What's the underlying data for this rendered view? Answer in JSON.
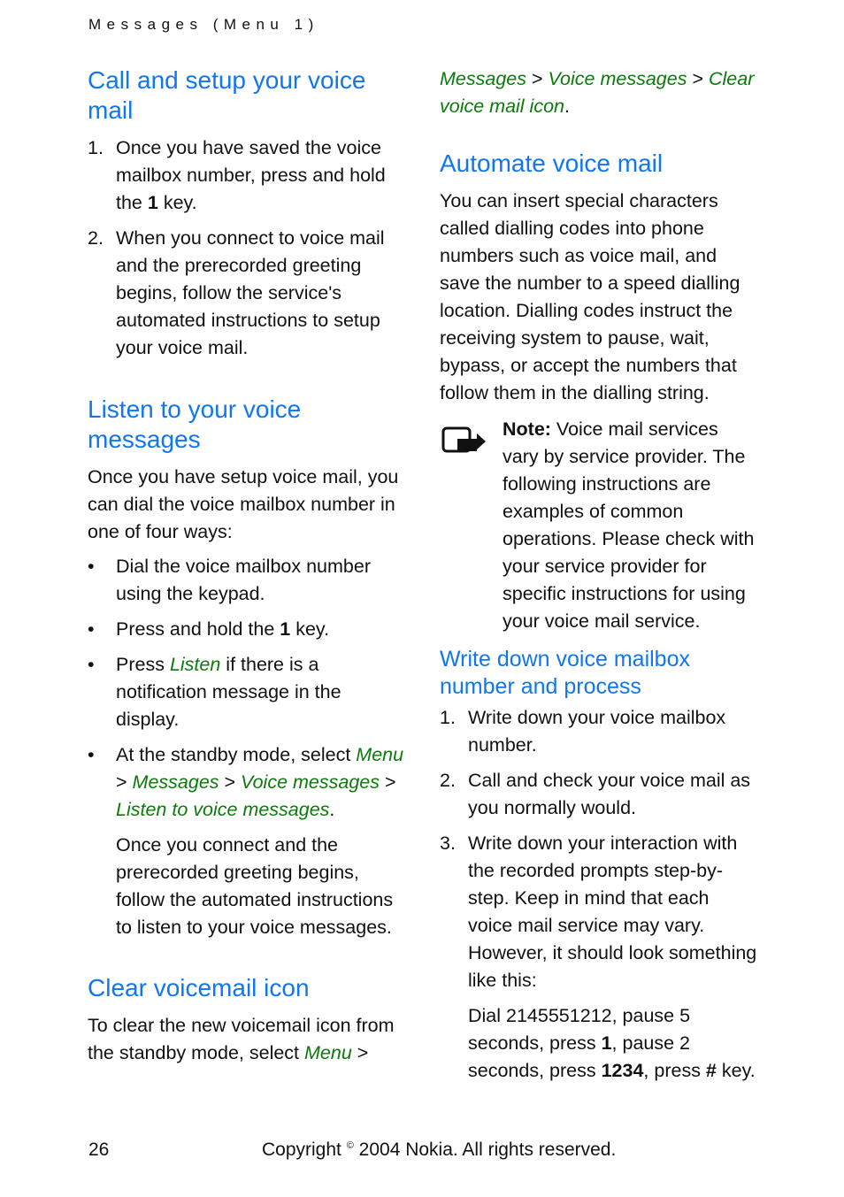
{
  "running_head": "Messages (Menu 1)",
  "left": {
    "s1_title": "Call and setup your voice mail",
    "s1_steps": [
      {
        "num": "1.",
        "pre": "Once you have saved the voice mailbox number, press and hold the ",
        "bold": "1",
        "post": " key."
      },
      {
        "num": "2.",
        "text": "When you connect to voice mail and the prerecorded greeting begins, follow the service's automated instructions to setup your voice mail."
      }
    ],
    "s2_title": "Listen to your voice messages",
    "s2_intro": "Once you have setup voice mail, you can dial the voice mailbox number in one of four ways:",
    "bullet": "•",
    "b1": "Dial the voice mailbox number using the keypad.",
    "b2_pre": "Press and hold the ",
    "b2_bold": "1",
    "b2_post": " key.",
    "b3_pre": "Press ",
    "b3_link": "Listen",
    "b3_post": " if there is a notification message in the display.",
    "b4_pre": "At the standby mode, select ",
    "b4_path": [
      "Menu",
      "Messages",
      "Voice messages",
      "Listen to voice messages"
    ],
    "sep": " > ",
    "period": ".",
    "b4_follow": "Once you connect and the prerecorded greeting begins, follow the automated instructions to listen to your voice messages.",
    "s3_title": "Clear voicemail icon",
    "s3_pre": "To clear the new voicemail icon from the standby mode, select ",
    "s3_link": "Menu"
  },
  "right": {
    "cont_path": [
      "Messages",
      "Voice messages",
      "Clear voice mail icon"
    ],
    "s4_title": "Automate voice mail",
    "s4_text": "You can insert special characters called dialling codes into phone numbers such as voice mail, and save the number to a speed dialling location. Dialling codes instruct the receiving system to pause, wait, bypass, or accept the numbers that follow them in the dialling string.",
    "note_label": "Note:",
    "note_text": " Voice mail services vary by service provider. The following instructions are examples of common operations. Please check with your service provider for specific instructions for using your voice mail service.",
    "s5_title": "Write down voice mailbox number and process",
    "steps": [
      {
        "num": "1.",
        "text": "Write down your voice mailbox number."
      },
      {
        "num": "2.",
        "text": "Call and check your voice mail as you normally would."
      },
      {
        "num": "3.",
        "text": "Write down your interaction with the recorded prompts step-by-step. Keep in mind that each voice mail service may vary. However, it should look something like this:"
      }
    ],
    "example": {
      "p1": "Dial 2145551212, pause 5 seconds, press ",
      "b1": "1",
      "p2": ", pause 2 seconds, press ",
      "b2": "1234",
      "p3": ", press ",
      "b3": "#",
      "p4": " key."
    }
  },
  "footer": {
    "page_number": "26",
    "copy_pre": "Copyright ",
    "copy_symbol": "©",
    "copy_post": " 2004 Nokia. All rights reserved."
  },
  "colors": {
    "heading": "#1177ee",
    "menu_path": "#0a7a0a",
    "text": "#111111"
  }
}
